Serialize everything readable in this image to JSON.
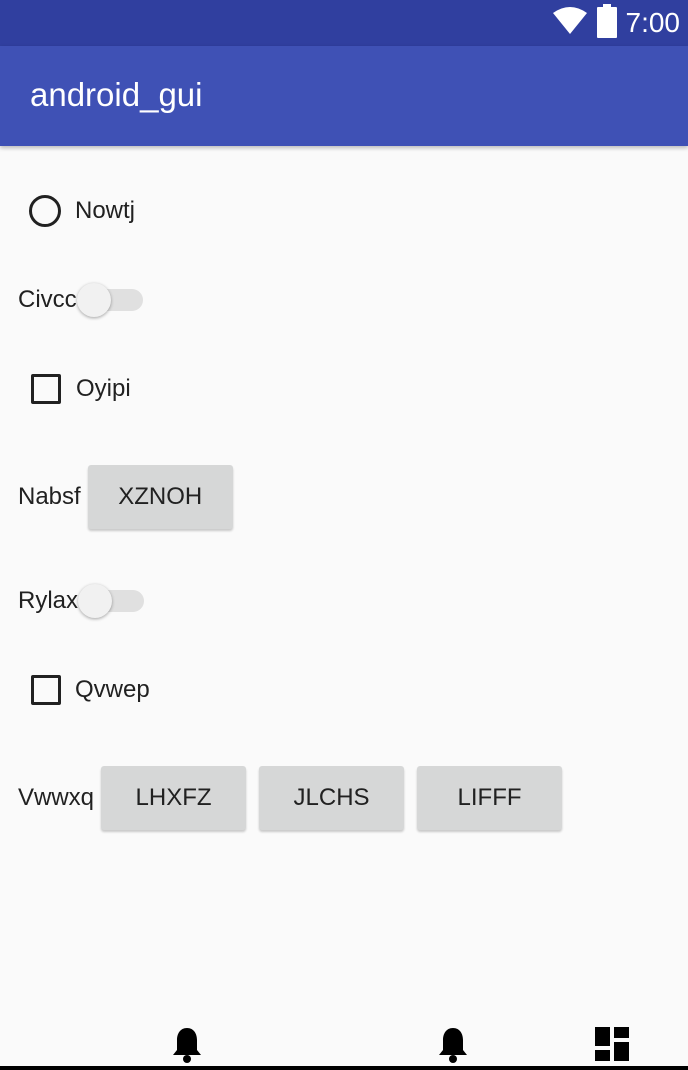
{
  "status_bar": {
    "time": "7:00",
    "icons": [
      "wifi-icon",
      "battery-icon"
    ],
    "color": "#303f9f"
  },
  "app_bar": {
    "title": "android_gui",
    "color": "#3f51b5"
  },
  "form": {
    "radio": {
      "label": "Nowtj",
      "checked": false
    },
    "switch1": {
      "label": "Civcc",
      "on": false
    },
    "checkbox1": {
      "label": "Oyipi",
      "checked": false
    },
    "button_row1": {
      "label": "Nabsf",
      "buttons": [
        "XZNOH"
      ]
    },
    "switch2": {
      "label": "Rylax",
      "on": false
    },
    "checkbox2": {
      "label": "Qvwep",
      "checked": false
    },
    "button_row2": {
      "label": "Vwwxq",
      "buttons": [
        "LHXFZ",
        "JLCHS",
        "LIFFF"
      ]
    }
  },
  "bottom_nav": {
    "icons": [
      "bell-icon",
      "bell-icon",
      "dashboard-icon"
    ]
  }
}
